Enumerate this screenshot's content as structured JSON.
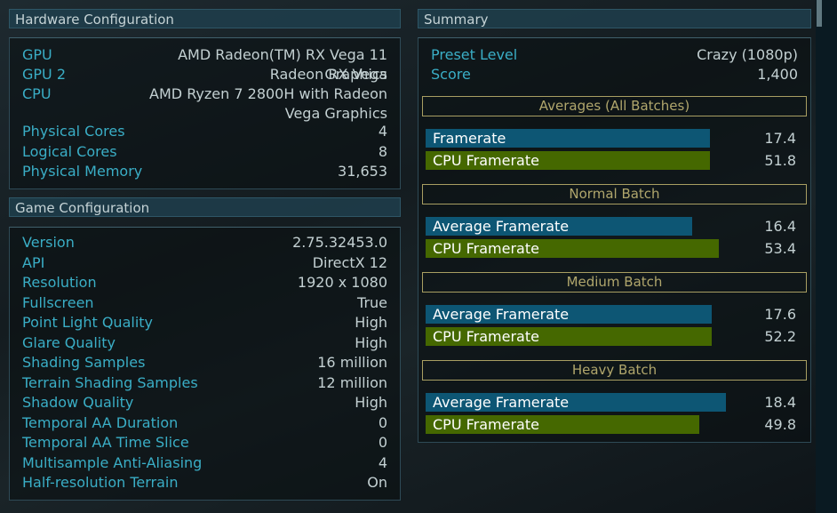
{
  "hardware": {
    "title": "Hardware Configuration",
    "rows": [
      {
        "label": "GPU",
        "value": "AMD Radeon(TM) RX Vega 11 Graphics"
      },
      {
        "label": "GPU 2",
        "value": "Radeon RX Vega"
      },
      {
        "label": "CPU",
        "value": "AMD Ryzen 7 2800H with Radeon Vega Graphics"
      },
      {
        "label": "Physical Cores",
        "value": "4"
      },
      {
        "label": "Logical Cores",
        "value": "8"
      },
      {
        "label": "Physical Memory",
        "value": "31,653"
      }
    ]
  },
  "game": {
    "title": "Game Configuration",
    "rows": [
      {
        "label": "Version",
        "value": "2.75.32453.0"
      },
      {
        "label": "API",
        "value": "DirectX 12"
      },
      {
        "label": "Resolution",
        "value": "1920 x 1080"
      },
      {
        "label": "Fullscreen",
        "value": "True"
      },
      {
        "label": "Point Light Quality",
        "value": "High"
      },
      {
        "label": "Glare Quality",
        "value": "High"
      },
      {
        "label": "Shading Samples",
        "value": "16 million"
      },
      {
        "label": "Terrain Shading Samples",
        "value": "12 million"
      },
      {
        "label": "Shadow Quality",
        "value": "High"
      },
      {
        "label": "Temporal AA Duration",
        "value": "0"
      },
      {
        "label": "Temporal AA Time Slice",
        "value": "0"
      },
      {
        "label": "Multisample Anti-Aliasing",
        "value": "4"
      },
      {
        "label": "Half-resolution Terrain",
        "value": "On"
      }
    ]
  },
  "summary": {
    "title": "Summary",
    "preset_label": "Preset Level",
    "preset_value": "Crazy (1080p)",
    "score_label": "Score",
    "score_value": "1,400",
    "sections": [
      {
        "title": "Averages (All Batches)",
        "bars": [
          {
            "label": "Framerate",
            "value": "17.4",
            "fill_pct": 80,
            "kind": "gpu"
          },
          {
            "label": "CPU Framerate",
            "value": "51.8",
            "fill_pct": 80,
            "kind": "cpu"
          }
        ]
      },
      {
        "title": "Normal Batch",
        "bars": [
          {
            "label": "Average Framerate",
            "value": "16.4",
            "fill_pct": 75,
            "kind": "gpu"
          },
          {
            "label": "CPU Framerate",
            "value": "53.4",
            "fill_pct": 82.5,
            "kind": "cpu"
          }
        ]
      },
      {
        "title": "Medium Batch",
        "bars": [
          {
            "label": "Average Framerate",
            "value": "17.6",
            "fill_pct": 80.5,
            "kind": "gpu"
          },
          {
            "label": "CPU Framerate",
            "value": "52.2",
            "fill_pct": 80.5,
            "kind": "cpu"
          }
        ]
      },
      {
        "title": "Heavy Batch",
        "bars": [
          {
            "label": "Average Framerate",
            "value": "18.4",
            "fill_pct": 84.5,
            "kind": "gpu"
          },
          {
            "label": "CPU Framerate",
            "value": "49.8",
            "fill_pct": 77,
            "kind": "cpu"
          }
        ]
      }
    ]
  },
  "colors": {
    "gpu_bar": "#0d5674",
    "cpu_bar": "#456800",
    "label": "#3aaec6",
    "section_border": "#a89e62"
  }
}
